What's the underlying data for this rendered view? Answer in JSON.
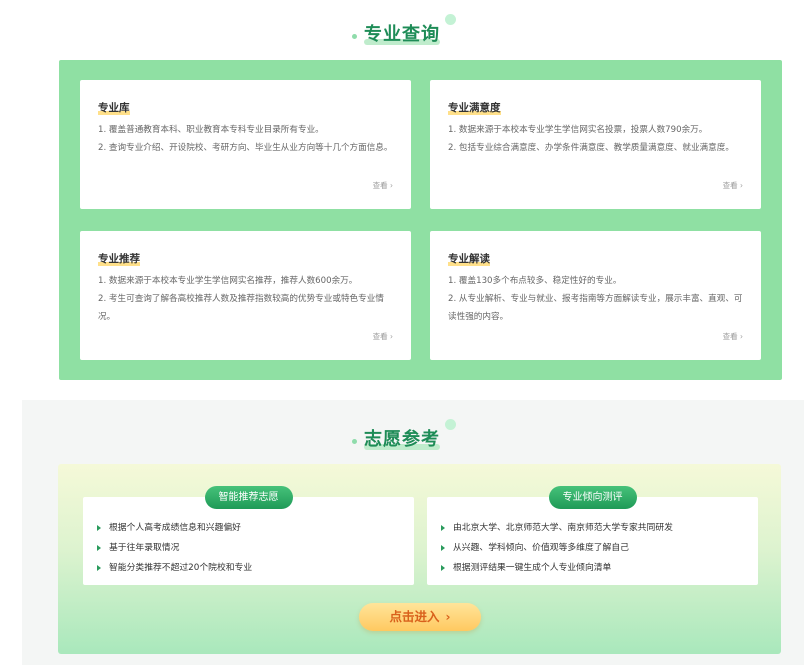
{
  "section1": {
    "title": "专业查询",
    "cards": [
      {
        "title": "专业库",
        "lines": [
          "1. 覆盖普通教育本科、职业教育本专科专业目录所有专业。",
          "2. 查询专业介绍、开设院校、考研方向、毕业生从业方向等十几个方面信息。"
        ],
        "more": "查看"
      },
      {
        "title": "专业满意度",
        "lines": [
          "1. 数据来源于本校本专业学生学信网实名投票，投票人数790余万。",
          "2. 包括专业综合满意度、办学条件满意度、教学质量满意度、就业满意度。"
        ],
        "more": "查看"
      },
      {
        "title": "专业推荐",
        "lines": [
          "1. 数据来源于本校本专业学生学信网实名推荐，推荐人数600余万。",
          "2. 考生可查询了解各高校推荐人数及推荐指数较高的优势专业或特色专业情况。"
        ],
        "more": "查看"
      },
      {
        "title": "专业解读",
        "lines": [
          "1. 覆盖130多个布点较多、稳定性好的专业。",
          "2. 从专业解析、专业与就业、报考指南等方面解读专业，展示丰富、直观、可读性强的内容。"
        ],
        "more": "查看"
      }
    ]
  },
  "section2": {
    "title": "志愿参考",
    "cards": [
      {
        "badge": "智能推荐志愿",
        "items": [
          "根据个人高考成绩信息和兴趣偏好",
          "基于往年录取情况",
          "智能分类推荐不超过20个院校和专业"
        ]
      },
      {
        "badge": "专业倾向测评",
        "items": [
          "由北京大学、北京师范大学、南京师范大学专家共同研发",
          "从兴趣、学科倾向、价值观等多维度了解自己",
          "根据测评结果一键生成个人专业倾向清单"
        ]
      }
    ],
    "button": "点击进入"
  },
  "icons": {
    "more_chevron": "chevron-right-icon",
    "list_bullet": "triangle-right-icon",
    "button_chevron": "chevron-right-icon"
  },
  "colors": {
    "brand_green": "#1e8c57",
    "panel_green": "#8fe0a3",
    "title_highlight": "#ffe08a",
    "button_yellow": "#ffc960",
    "button_text": "#d9611c"
  }
}
